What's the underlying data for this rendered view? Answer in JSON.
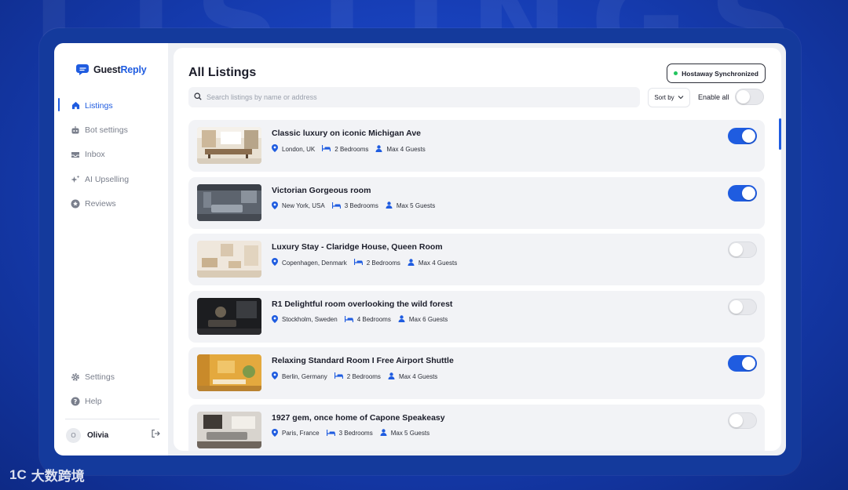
{
  "background_word": "LISTINGS",
  "sidebar": {
    "brand": {
      "part1": "Guest",
      "part2": "Reply"
    },
    "nav": [
      {
        "label": "Listings",
        "icon": "home-icon",
        "active": true
      },
      {
        "label": "Bot settings",
        "icon": "bot-icon",
        "active": false
      },
      {
        "label": "Inbox",
        "icon": "inbox-icon",
        "active": false
      },
      {
        "label": "AI Upselling",
        "icon": "sparkle-icon",
        "active": false
      },
      {
        "label": "Reviews",
        "icon": "star-icon",
        "active": false
      }
    ],
    "bottom_nav": [
      {
        "label": "Settings",
        "icon": "gear-icon"
      },
      {
        "label": "Help",
        "icon": "help-icon"
      }
    ],
    "user": {
      "initial": "O",
      "name": "Olivia"
    }
  },
  "main": {
    "title": "All Listings",
    "sync_badge": "Hostaway Synchronized",
    "search_placeholder": "Search listings by name or address",
    "sort_label": "Sort by",
    "enable_all_label": "Enable all",
    "enable_all_on": false,
    "listings": [
      {
        "title": "Classic luxury on iconic Michigan Ave",
        "location": "London, UK",
        "bedrooms": "2 Bedrooms",
        "guests": "Max 4 Guests",
        "enabled": true,
        "thumb": "kitchen"
      },
      {
        "title": "Victorian Gorgeous room",
        "location": "New York, USA",
        "bedrooms": "3 Bedrooms",
        "guests": "Max 5 Guests",
        "enabled": true,
        "thumb": "grey-living"
      },
      {
        "title": "Luxury Stay - Claridge House, Queen Room",
        "location": "Copenhagen, Denmark",
        "bedrooms": "2 Bedrooms",
        "guests": "Max 4 Guests",
        "enabled": false,
        "thumb": "beige-room"
      },
      {
        "title": "R1 Delightful room overlooking the wild forest",
        "location": "Stockholm, Sweden",
        "bedrooms": "4 Bedrooms",
        "guests": "Max 6 Guests",
        "enabled": false,
        "thumb": "dark-room"
      },
      {
        "title": "Relaxing Standard Room I Free Airport Shuttle",
        "location": "Berlin, Germany",
        "bedrooms": "2 Bedrooms",
        "guests": "Max 4 Guests",
        "enabled": true,
        "thumb": "yellow-room"
      },
      {
        "title": "1927 gem, once home of Capone Speakeasy",
        "location": "Paris, France",
        "bedrooms": "3 Bedrooms",
        "guests": "Max 5 Guests",
        "enabled": false,
        "thumb": "art-living"
      }
    ]
  },
  "watermark": {
    "logo": "1C",
    "text": "大数跨境"
  },
  "colors": {
    "accent": "#1f5ce0",
    "sync_dot": "#22c55e",
    "toggle_off": "#e7e8ec"
  }
}
